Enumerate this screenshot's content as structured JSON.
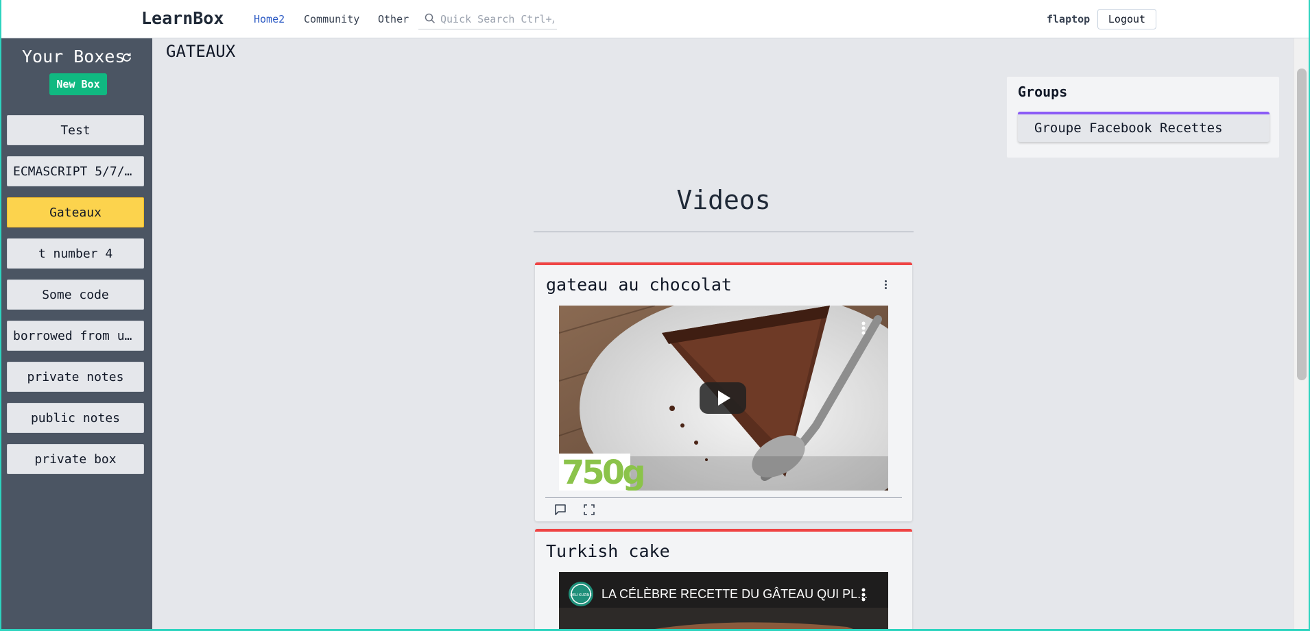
{
  "header": {
    "brand": "LearnBox",
    "nav": [
      {
        "label": "Home2"
      },
      {
        "label": "Community"
      },
      {
        "label": "Other"
      }
    ],
    "search_placeholder": "Quick Search Ctrl+/",
    "username": "flaptop",
    "logout_label": "Logout"
  },
  "sidebar": {
    "title": "Your Boxes",
    "new_box_label": "New Box",
    "boxes": [
      {
        "label": "Test"
      },
      {
        "label": "ECMASCRIPT 5/7/…"
      },
      {
        "label": "Gateaux",
        "active": true
      },
      {
        "label": "t number 4"
      },
      {
        "label": "Some code"
      },
      {
        "label": "borrowed from u…"
      },
      {
        "label": "private notes"
      },
      {
        "label": "public notes"
      },
      {
        "label": "private box"
      }
    ]
  },
  "main": {
    "page_title": "GATEAUX",
    "section_title": "Videos",
    "videos": [
      {
        "title": "gateau au chocolat",
        "watermark": "750g"
      },
      {
        "title": "Turkish cake",
        "video_title": "LA CÉLÈBRE RECETTE DU GÂTEAU QUI PL...",
        "channel_logo": "DELI KUZINE"
      }
    ]
  },
  "groups": {
    "title": "Groups",
    "items": [
      {
        "label": "Groupe Facebook Recettes"
      }
    ]
  },
  "colors": {
    "accent_nav": "#2b59c3",
    "new_box": "#10b981",
    "active_box": "#fcd34d",
    "group_accent": "#8b5cf6",
    "video_accent": "#ef4444",
    "sidebar_bg": "#4b5563"
  }
}
